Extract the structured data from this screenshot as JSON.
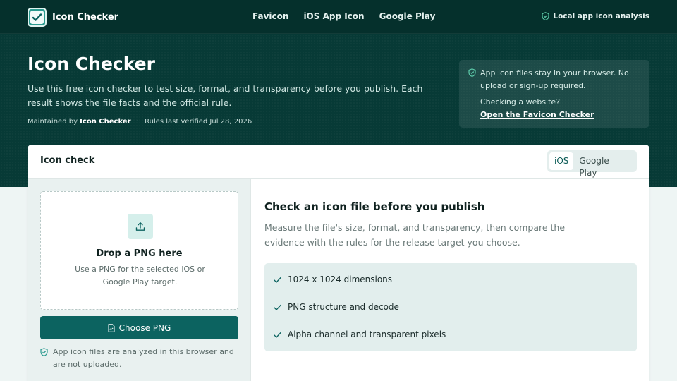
{
  "brand": {
    "name": "Icon Checker",
    "logo_icon": "checkbox-logo-icon"
  },
  "nav": {
    "items": [
      "Favicon",
      "iOS App Icon",
      "Google Play"
    ]
  },
  "header_badge": {
    "text": "Local app icon analysis",
    "icon": "shield-check-icon"
  },
  "hero": {
    "title": "Icon Checker",
    "subtitle": "Use this free icon checker to test size, format, and transparency before you publish. Each result shows the file facts and the official rule.",
    "maintained_prefix": "Maintained by",
    "maintained_by": "Icon Checker",
    "separator": "·",
    "verified": "Rules last verified Jul 28, 2026"
  },
  "privacy": {
    "text": "App icon files stay in your browser. No upload or sign-up required.",
    "question": "Checking a website?",
    "link": "Open the Favicon Checker"
  },
  "card": {
    "title": "Icon check",
    "platforms": [
      "iOS",
      "Google Play"
    ],
    "selected_platform": "iOS"
  },
  "upload": {
    "title": "Drop a PNG here",
    "help": "Use a PNG for the selected iOS or Google Play target.",
    "button": "Choose PNG",
    "note": "App icon files are analyzed in this browser and are not uploaded."
  },
  "result": {
    "title": "Check an icon file before you publish",
    "description": "Measure the file's size, format, and transparency, then compare the evidence with the rules for the release target you choose.",
    "checks": [
      "1024 x 1024 dimensions",
      "PNG structure and decode",
      "Alpha channel and transparent pixels"
    ]
  },
  "colors": {
    "header_bg": "#073a36",
    "accent": "#0c6360",
    "page_bg": "#eef5f4"
  }
}
